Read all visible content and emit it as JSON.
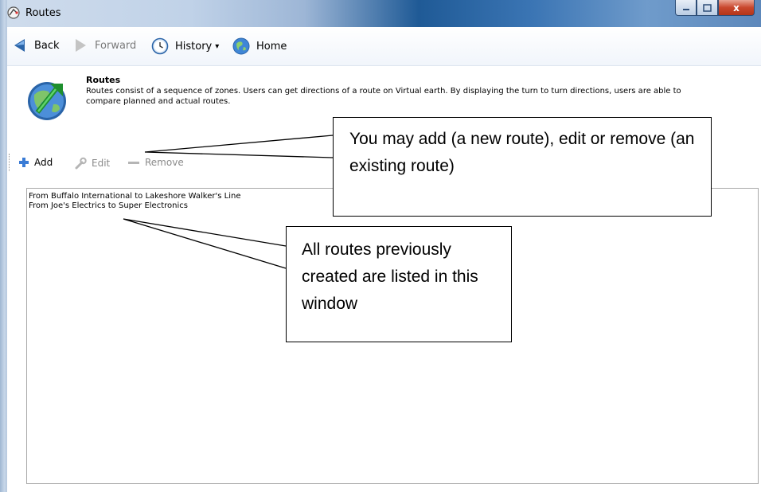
{
  "window": {
    "title": "Routes",
    "icon": "routes-icon",
    "controls": {
      "minimize_icon": "minimize-icon",
      "maximize_icon": "maximize-icon",
      "close_label": "x"
    }
  },
  "nav": {
    "back": "Back",
    "forward": "Forward",
    "history": "History",
    "history_arrow": "▾",
    "home": "Home"
  },
  "info": {
    "title": "Routes",
    "description": "Routes consist of a sequence of zones. Users can get directions of a route on Virtual earth. By displaying the turn to turn directions, users are able to compare planned and actual routes."
  },
  "toolbar": {
    "add": "Add",
    "edit": "Edit",
    "remove": "Remove"
  },
  "routes": [
    "From Buffalo International to Lakeshore Walker's Line",
    "From Joe's Electrics to Super Electronics"
  ],
  "callouts": {
    "toolbar_note": "You may add (a new route), edit or remove (an existing route)",
    "list_note": "All routes previously created are listed in this window"
  },
  "colors": {
    "accent": "#2a64a8",
    "titlebar_dark": "#1f5a96",
    "add_icon": "#3a7bd5",
    "close_button": "#c9472c"
  }
}
